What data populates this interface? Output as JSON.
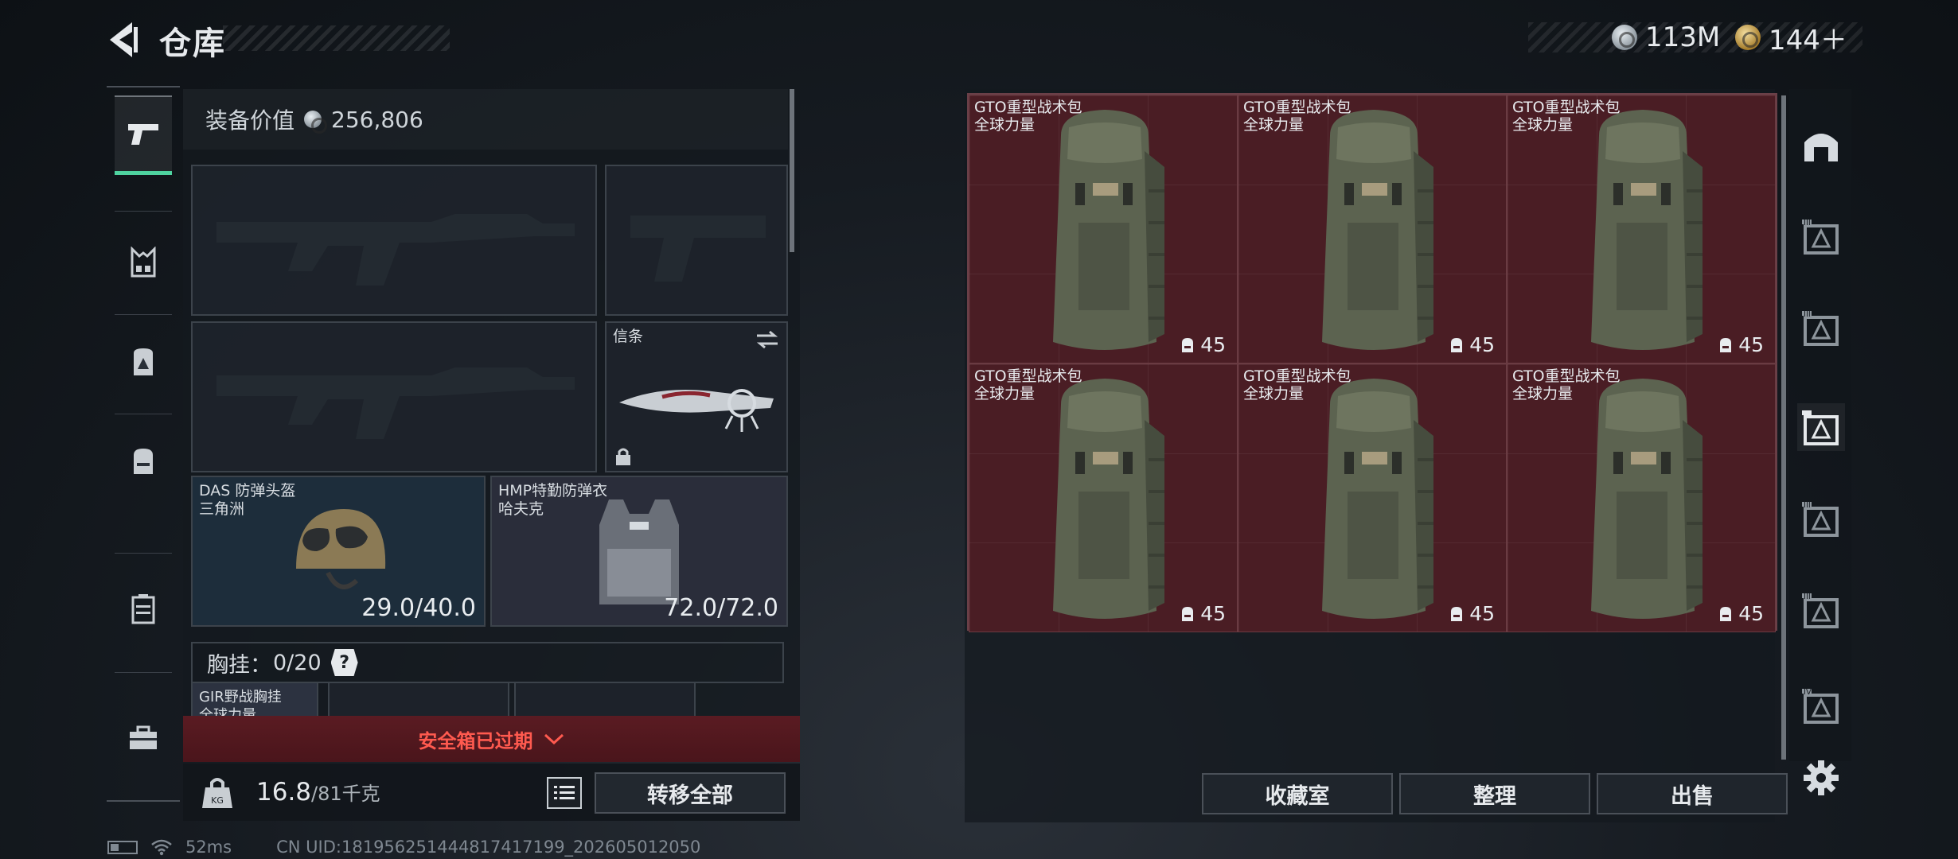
{
  "header": {
    "title": "仓库"
  },
  "currency": {
    "silver_amount": "113M",
    "gold_amount": "144＋"
  },
  "left_rail": {
    "items": [
      {
        "icon": "pistol-icon",
        "active": true
      },
      {
        "icon": "vest-rig-icon",
        "active": false
      },
      {
        "icon": "backpack-sign-icon",
        "active": false
      },
      {
        "icon": "backpack-icon",
        "active": false
      },
      {
        "icon": "case-icon",
        "active": false
      },
      {
        "icon": "toolbox-icon",
        "active": false
      }
    ]
  },
  "equipment": {
    "value_label": "装备价值",
    "value_amount": "256,806",
    "slots": {
      "primary_1": {
        "label": ""
      },
      "sidearm": {
        "label": ""
      },
      "primary_2": {
        "label": ""
      },
      "melee": {
        "label": "信条"
      },
      "helmet": {
        "label": "DAS 防弹头盔",
        "sub": "三角洲",
        "durability": "29.0/40.0"
      },
      "armor": {
        "label": "HMP特勤防弹衣",
        "sub": "哈夫克",
        "durability": "72.0/72.0"
      }
    },
    "chest_rig": {
      "label": "胸挂：",
      "capacity": "0/20",
      "help": "?"
    },
    "chest_item": {
      "label": "GIR野战胸挂",
      "sub": "全球力量"
    }
  },
  "safebox": {
    "expired_text": "安全箱已过期"
  },
  "weight": {
    "current": "16.8",
    "max": "/81千克"
  },
  "actions": {
    "transfer_all": "转移全部"
  },
  "storage": {
    "items": [
      {
        "name": "GTO重型战术包",
        "faction": "全球力量",
        "count": "45"
      },
      {
        "name": "GTO重型战术包",
        "faction": "全球力量",
        "count": "45"
      },
      {
        "name": "GTO重型战术包",
        "faction": "全球力量",
        "count": "45"
      },
      {
        "name": "GTO重型战术包",
        "faction": "全球力量",
        "count": "45"
      },
      {
        "name": "GTO重型战术包",
        "faction": "全球力量",
        "count": "45"
      },
      {
        "name": "GTO重型战术包",
        "faction": "全球力量",
        "count": "45"
      }
    ],
    "buttons": {
      "collection": "收藏室",
      "organize": "整理",
      "sell": "出售"
    }
  },
  "right_rail": {
    "items": [
      {
        "icon": "shelter-icon"
      },
      {
        "icon": "container-3-icon",
        "tier": "III"
      },
      {
        "icon": "container-3-icon",
        "tier": "III"
      },
      {
        "icon": "container-active-icon",
        "tier": ""
      },
      {
        "icon": "container-3-icon",
        "tier": "III"
      },
      {
        "icon": "container-3-icon",
        "tier": "III"
      },
      {
        "icon": "container-4-icon",
        "tier": "IV"
      }
    ]
  },
  "footer": {
    "ping": "52ms",
    "uid": "CN UID:18195625144481741719​9_202605012050"
  },
  "colors": {
    "accent": "#4fd3a0",
    "alert": "#ff5a4f",
    "grid_cell": "#4a1d24"
  }
}
